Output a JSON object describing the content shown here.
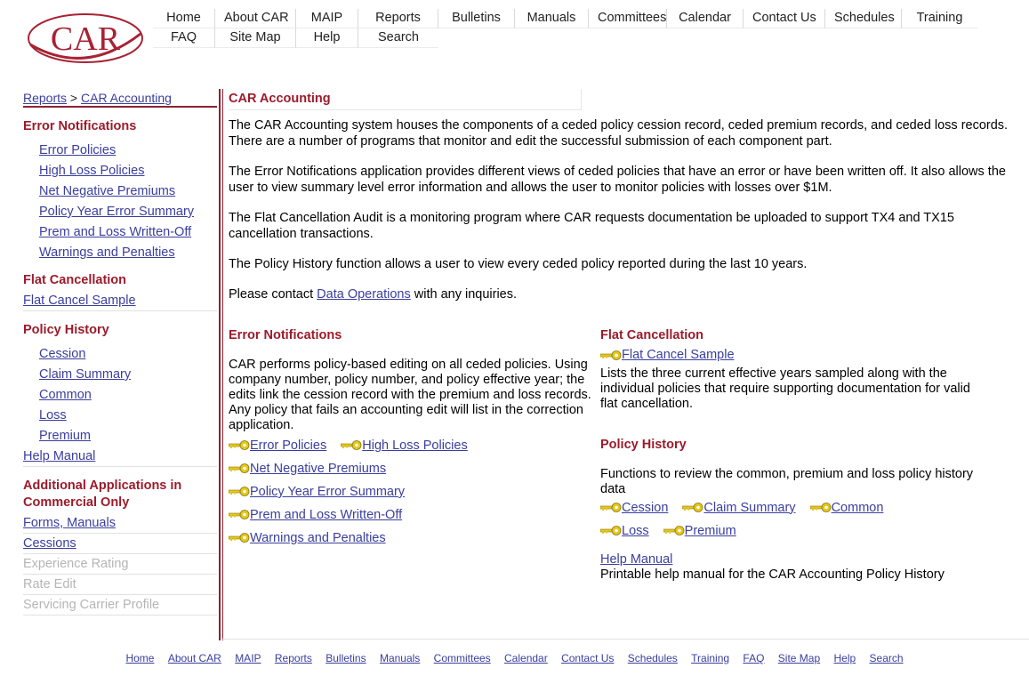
{
  "logo": {
    "text": "CAR"
  },
  "topnav": {
    "row1": [
      "Home",
      "About CAR",
      "MAIP",
      "Reports",
      "Bulletins",
      "Manuals",
      "Committees",
      "Calendar",
      "Contact Us",
      "Schedules",
      "Training"
    ],
    "row2": [
      "FAQ",
      "Site Map",
      "Help",
      "Search"
    ]
  },
  "breadcrumb": {
    "root": "Reports",
    "separator": ">",
    "current": "CAR Accounting"
  },
  "sidebar": {
    "error_notifications": {
      "heading": "Error Notifications",
      "items": [
        "Error Policies",
        "High Loss Policies",
        "Net Negative Premiums",
        "Policy Year Error Summary",
        "Prem and Loss Written-Off",
        "Warnings and Penalties"
      ]
    },
    "flat_cancellation": {
      "heading": "Flat Cancellation",
      "item": "Flat Cancel Sample"
    },
    "policy_history": {
      "heading": "Policy History",
      "items": [
        "Cession",
        "Claim Summary",
        "Common",
        "Loss",
        "Premium"
      ]
    },
    "help_manual": "Help Manual",
    "additional": {
      "heading": "Additional Applications in Commercial Only",
      "links": [
        "Forms, Manuals",
        "Cessions"
      ],
      "disabled": [
        "Experience Rating",
        "Rate Edit",
        "Servicing Carrier Profile"
      ]
    }
  },
  "main": {
    "title": "CAR Accounting",
    "para1": "The CAR Accounting system houses the components of a ceded policy cession record, ceded premium records, and ceded loss records. There are a number of programs that monitor and edit the successful submission of each component part.",
    "para2": "The Error Notifications application provides different views of ceded policies that have an error or have been written off. It also allows the user to view summary level error information and allows the user to monitor policies with losses over $1M.",
    "para3": "The Flat Cancellation Audit is a monitoring program where CAR requests documentation be uploaded to support TX4 and TX15 cancellation transactions.",
    "para4": "The Policy History function allows a user to view every ceded policy reported during the last 10 years.",
    "contact_prefix": "Please contact ",
    "contact_link": "Data Operations",
    "contact_suffix": " with any inquiries."
  },
  "error_section": {
    "heading": "Error Notifications",
    "text": "CAR performs policy-based editing on all ceded policies. Using company number, policy number, and policy effective year; the edits link the cession record with the premium and loss records. Any policy that fails an accounting edit will list in the correction application.",
    "links": [
      "Error Policies",
      "High Loss Policies",
      "Net Negative Premiums",
      "Policy Year Error Summary",
      "Prem and Loss Written-Off",
      "Warnings and Penalties"
    ]
  },
  "flat_section": {
    "heading": "Flat Cancellation",
    "link": "Flat Cancel Sample",
    "text": "Lists the three current effective years sampled along with the individual policies that require supporting documentation for valid flat cancellation."
  },
  "policy_section": {
    "heading": "Policy History",
    "text": "Functions to review the common, premium and loss policy history data",
    "links": [
      "Cession",
      "Claim Summary",
      "Common",
      "Loss",
      "Premium"
    ],
    "help_link": "Help Manual",
    "help_text": "Printable help manual for the CAR Accounting Policy History"
  },
  "footer": [
    "Home",
    "About CAR",
    "MAIP",
    "Reports",
    "Bulletins",
    "Manuals",
    "Committees",
    "Calendar",
    "Contact Us",
    "Schedules",
    "Training",
    "FAQ",
    "Site Map",
    "Help",
    "Search"
  ],
  "colors": {
    "accent": "#9b1b2b",
    "link": "#3a3e9e",
    "disabled": "#b5b5b5",
    "key": "#e6c619"
  }
}
